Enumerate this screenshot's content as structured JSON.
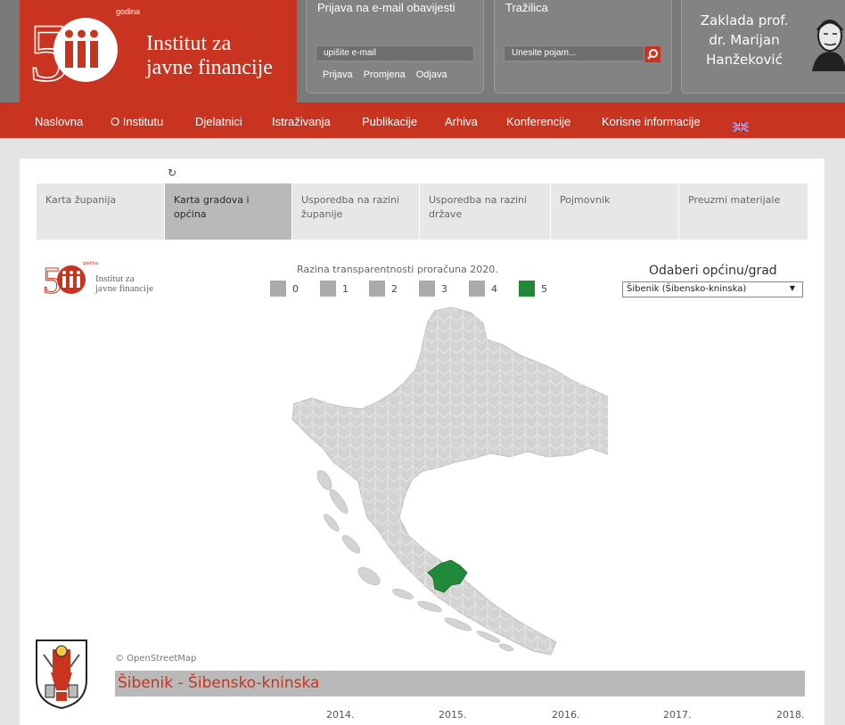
{
  "header": {
    "logo_godina": "godina",
    "logo_name_line1": "Institut za",
    "logo_name_line2": "javne financije",
    "newsletter": {
      "title": "Prijava na e-mail obavijesti",
      "email_placeholder": "upišite e-mail",
      "links": [
        "Prijava",
        "Promjena",
        "Odjava"
      ]
    },
    "search": {
      "title": "Tražilica",
      "placeholder": "Unesite pojam..."
    },
    "foundation": {
      "line1": "Zaklada prof.",
      "line2": "dr. Marijan",
      "line3": "Hanžeković"
    }
  },
  "nav": {
    "items": [
      "Naslovna",
      "O Institutu",
      "Djelatnici",
      "Istraživanja",
      "Publikacije",
      "Arhiva",
      "Konferencije",
      "Korisne informacije"
    ]
  },
  "tabs": [
    {
      "label": "Karta županija",
      "active": false
    },
    {
      "label": "Karta gradova i općina",
      "active": true
    },
    {
      "label": "Usporedba na razini županije",
      "active": false
    },
    {
      "label": "Usporedba na razini države",
      "active": false
    },
    {
      "label": "Pojmovnik",
      "active": false
    },
    {
      "label": "Preuzmi materijale",
      "active": false
    }
  ],
  "small_logo": {
    "line1": "Institut za",
    "line2": "javne financije",
    "godina": "godina"
  },
  "legend": {
    "title": "Razina transparentnosti proračuna 2020.",
    "levels": [
      {
        "label": "0",
        "color": "#aaaaaa"
      },
      {
        "label": "1",
        "color": "#aaaaaa"
      },
      {
        "label": "2",
        "color": "#aaaaaa"
      },
      {
        "label": "3",
        "color": "#aaaaaa"
      },
      {
        "label": "4",
        "color": "#aaaaaa"
      },
      {
        "label": "5",
        "color": "#218a3a"
      }
    ]
  },
  "selector": {
    "title": "Odaberi općinu/grad",
    "selected": "Šibenik (Šibensko-kninska)"
  },
  "map": {
    "attribution": "© OpenStreetMap",
    "base_color": "#d3d3d3",
    "highlight_color": "#218a3a"
  },
  "municipality": {
    "name": "Šibenik - Šibensko-kninska"
  },
  "years": [
    "2014.",
    "2015.",
    "2016.",
    "2017.",
    "2018."
  ],
  "colors": {
    "brand_red": "#c8341f",
    "header_grey": "#7a7a7a"
  }
}
